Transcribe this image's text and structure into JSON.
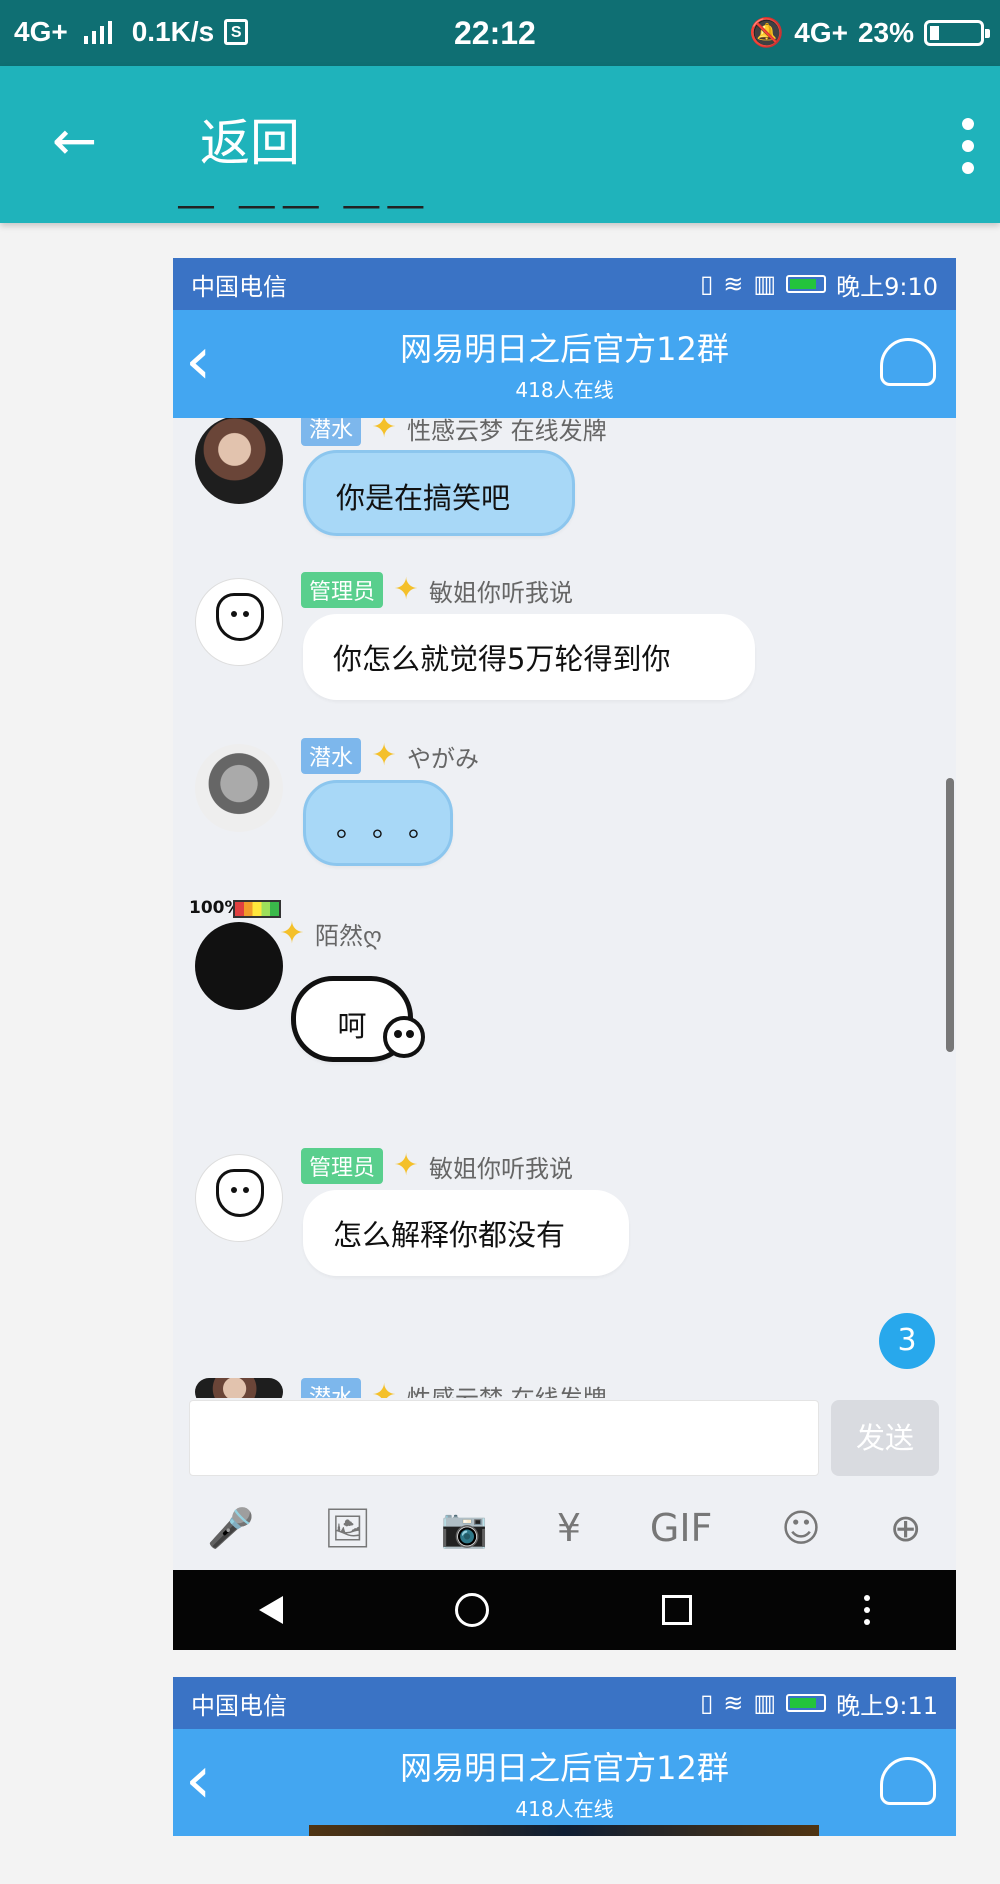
{
  "status": {
    "network": "4G+",
    "speed": "0.1K/s",
    "time": "22:12",
    "right_network": "4G+",
    "battery": "23%"
  },
  "header": {
    "back_label": "返回",
    "back_icon": "arrow-left-icon",
    "more_icon": "more-vertical-icon"
  },
  "screenshot1": {
    "carrier": "中国电信",
    "time": "晚上9:10",
    "group_title": "网易明日之后官方12群",
    "online": "418人在线",
    "messages": [
      {
        "tag": "潜水",
        "name": "性感云梦 在线发牌",
        "text": "你是在搞笑吧"
      },
      {
        "tag": "管理员",
        "name": "敏姐你听我说",
        "text": "你怎么就觉得5万轮得到你"
      },
      {
        "tag": "潜水",
        "name": "やがみ",
        "text": "。。。"
      },
      {
        "tag": "",
        "name": "陌然ღ",
        "text": "呵",
        "badge": "100%"
      },
      {
        "tag": "管理员",
        "name": "敏姐你听我说",
        "text": "怎么解释你都没有"
      }
    ],
    "partial_message": {
      "tag": "潜水",
      "name": "性感云梦 在线发牌"
    },
    "unread_count": "3",
    "input_placeholder": "",
    "send_label": "发送",
    "tools": [
      "mic-icon",
      "image-icon",
      "camera-icon",
      "red-packet-icon",
      "gif-icon",
      "emoji-icon",
      "plus-icon"
    ]
  },
  "screenshot2": {
    "carrier": "中国电信",
    "time": "晚上9:11",
    "group_title": "网易明日之后官方12群",
    "online": "418人在线"
  },
  "colors": {
    "outer_status": "#0f6f73",
    "top_bar": "#1fb3bb",
    "inner_status": "#3a73c5",
    "inner_header": "#43a6f1",
    "admin_tag": "#59cf8d",
    "diver_tag": "#7db7ec"
  }
}
